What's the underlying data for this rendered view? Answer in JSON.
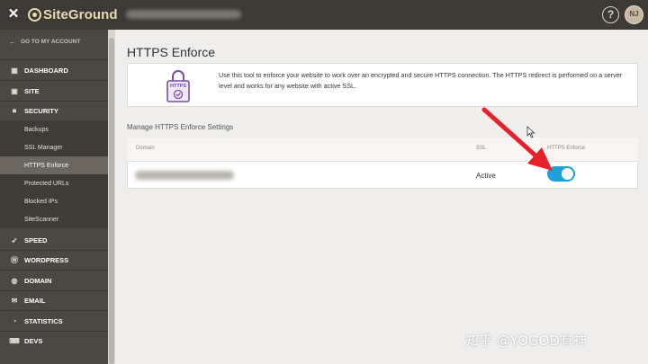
{
  "topbar": {
    "close_symbol": "✕",
    "logo_text": "SiteGround",
    "help_symbol": "?",
    "avatar_initials": "NJ"
  },
  "sidebar": {
    "back_label": "GO TO MY ACCOUNT",
    "items": [
      {
        "label": "DASHBOARD",
        "icon": "dashboard-icon"
      },
      {
        "label": "SITE",
        "icon": "site-icon"
      },
      {
        "label": "SECURITY",
        "icon": "lock-icon"
      },
      {
        "label": "SPEED",
        "icon": "rocket-icon"
      },
      {
        "label": "WORDPRESS",
        "icon": "wordpress-icon"
      },
      {
        "label": "DOMAIN",
        "icon": "globe-icon"
      },
      {
        "label": "EMAIL",
        "icon": "envelope-icon"
      },
      {
        "label": "STATISTICS",
        "icon": "chart-icon"
      },
      {
        "label": "DEVS",
        "icon": "code-icon"
      }
    ],
    "security_sub": [
      "Backups",
      "SSL Manager",
      "HTTPS Enforce",
      "Protected URLs",
      "Blocked IPs",
      "SiteScanner"
    ],
    "active_sub": "HTTPS Enforce"
  },
  "main": {
    "title": "HTTPS Enforce",
    "info_text": "Use this tool to enforce your website to work over an encrypted and secure HTTPS connection. The HTTPS redirect is performed on a server level and works for any website with active SSL.",
    "lock_label": "HTTPS",
    "section_label": "Manage HTTPS Enforce Settings",
    "table": {
      "headers": [
        "Domain",
        "SSL",
        "HTTPS Enforce"
      ],
      "rows": [
        {
          "ssl": "Active",
          "https_enforce": true
        }
      ]
    }
  },
  "colors": {
    "topbar": "#3d3a36",
    "sidebar": "#4b4741",
    "toggle_on": "#1da1dd",
    "annotation_arrow": "#e8202a",
    "logo": "#e9d9b2"
  },
  "watermark": "知乎 @YOGOD有神"
}
